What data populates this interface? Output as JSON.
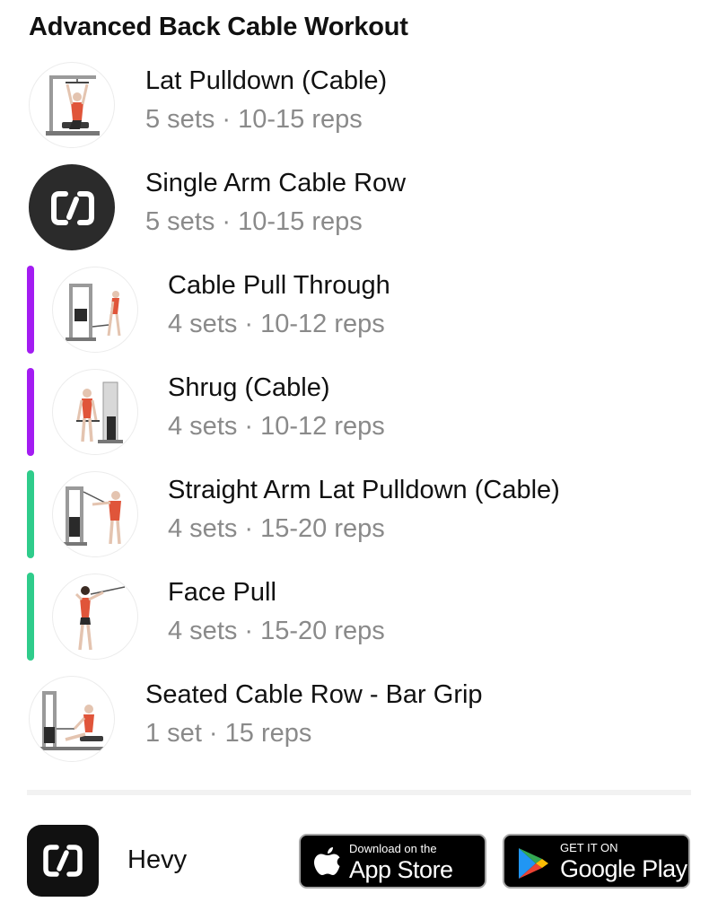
{
  "workout": {
    "title": "Advanced Back Cable Workout",
    "exercises": [
      {
        "name": "Lat Pulldown (Cable)",
        "detail": "5 sets · 10-15 reps",
        "superset_color": null,
        "icon": "lat-pulldown-illustration"
      },
      {
        "name": "Single Arm Cable Row",
        "detail": "5 sets · 10-15 reps",
        "superset_color": null,
        "icon": "hevy-logo-icon"
      },
      {
        "name": "Cable Pull Through",
        "detail": "4 sets · 10-12 reps",
        "superset_color": "#a31cf2",
        "icon": "cable-pull-through-illustration"
      },
      {
        "name": "Shrug (Cable)",
        "detail": "4 sets · 10-12 reps",
        "superset_color": "#a31cf2",
        "icon": "cable-shrug-illustration"
      },
      {
        "name": "Straight Arm Lat Pulldown (Cable)",
        "detail": "4 sets · 15-20 reps",
        "superset_color": "#2fcc8b",
        "icon": "straight-arm-pulldown-illustration"
      },
      {
        "name": "Face Pull",
        "detail": "4 sets · 15-20 reps",
        "superset_color": "#2fcc8b",
        "icon": "face-pull-illustration"
      },
      {
        "name": "Seated Cable Row - Bar Grip",
        "detail": "1 set · 15 reps",
        "superset_color": null,
        "icon": "seated-cable-row-illustration"
      }
    ]
  },
  "footer": {
    "app_name": "Hevy",
    "app_store": {
      "small": "Download on the",
      "big": "App Store"
    },
    "google_play": {
      "small": "GET IT ON",
      "big": "Google Play"
    }
  },
  "colors": {
    "superset_purple": "#a31cf2",
    "superset_green": "#2fcc8b",
    "muscle_highlight": "#e0553a",
    "secondary_text": "#8a8a8a"
  }
}
